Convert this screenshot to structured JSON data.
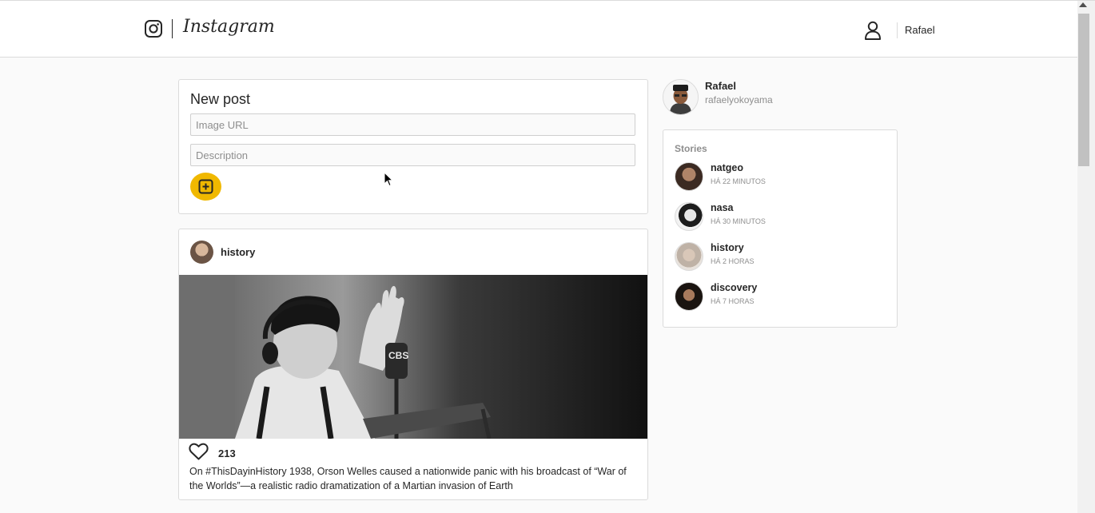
{
  "header": {
    "logo_text": "Instagram",
    "username": "Rafael"
  },
  "new_post": {
    "title": "New post",
    "image_url_placeholder": "Image URL",
    "description_placeholder": "Description",
    "add_icon": "plus-square-icon"
  },
  "post": {
    "username": "history",
    "likes": "213",
    "caption": "On #ThisDayinHistory 1938, Orson Welles caused a nationwide panic with his broadcast of “War of the Worlds”—a realistic radio dramatization of a Martian invasion of Earth",
    "image_alt_badge": "CBS"
  },
  "profile": {
    "name": "Rafael",
    "handle": "rafaelyokoyama"
  },
  "stories": {
    "title": "Stories",
    "items": [
      {
        "name": "natgeo",
        "time": "HÁ 22 MINUTOS"
      },
      {
        "name": "nasa",
        "time": "HÁ 30 MINUTOS"
      },
      {
        "name": "history",
        "time": "HÁ 2 HORAS"
      },
      {
        "name": "discovery",
        "time": "HÁ 7 HORAS"
      }
    ]
  },
  "colors": {
    "accent": "#f0b800",
    "border": "#dbdbdb",
    "background": "#fafafa"
  }
}
